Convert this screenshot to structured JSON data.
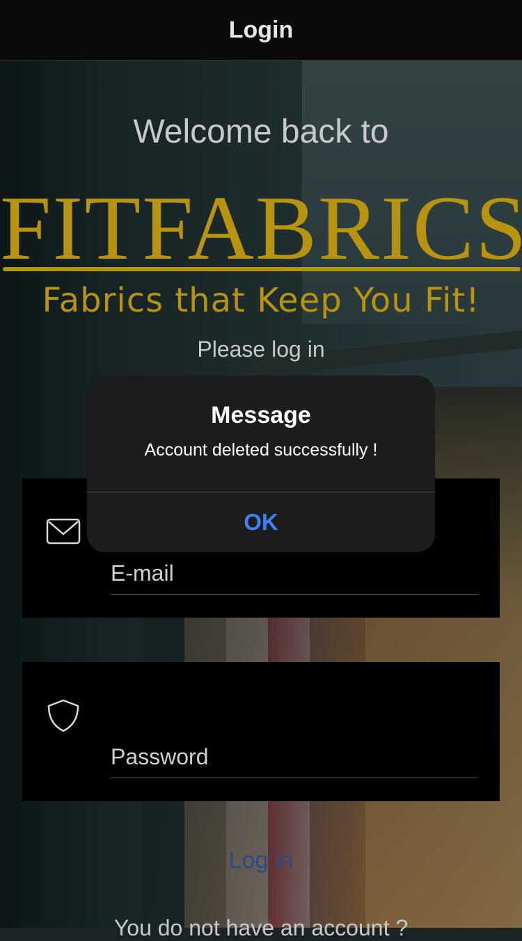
{
  "header": {
    "title": "Login"
  },
  "welcome_text": "Welcome back to",
  "brand": {
    "name": "FITFABRICS",
    "tagline": "Fabrics that Keep You Fit!",
    "color": "#b8940e"
  },
  "prompt_text": "Please log in",
  "form": {
    "email": {
      "placeholder": "E-mail",
      "value": "",
      "icon": "mail-icon"
    },
    "password": {
      "placeholder": "Password",
      "value": "",
      "icon": "shield-icon"
    },
    "login_label": "Log in",
    "signup_prompt": "You do not have an account ?"
  },
  "alert": {
    "title": "Message",
    "message": "Account deleted successfully !",
    "ok_label": "OK",
    "ok_color": "#3b82f6"
  }
}
